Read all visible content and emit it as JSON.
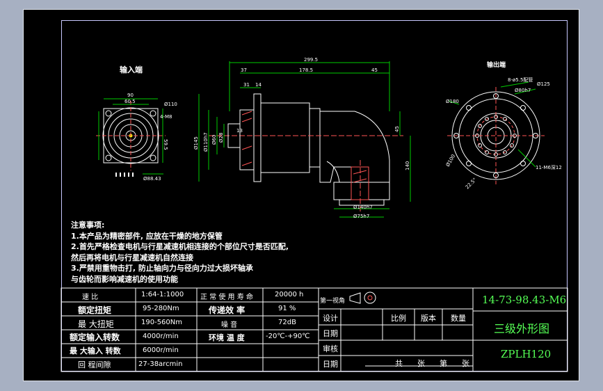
{
  "views": {
    "input_end_title": "输入端",
    "output_end_title": "输出端"
  },
  "dims": {
    "top_overall": "299.5",
    "len_37": "37",
    "len_178_5": "178.5",
    "len_45": "45",
    "len_31": "31",
    "len_14": "14",
    "left_90": "90",
    "left_60_5": "60.5",
    "left_dia110": "Ø110",
    "left_4_m8": "4-M8",
    "left_59_5": "59.5",
    "left_88_43": "Ø88.43",
    "mid_dia145": "Ø145",
    "mid_dia110": "Ø110h7",
    "mid_dia60": "Ø60",
    "mid_dia28": "Ø28",
    "mid_h7": "h7",
    "mid_45": "45",
    "mid_140": "140",
    "mid_13": "13",
    "bot_dia160": "Ø140h7",
    "bot_dia75": "Ø75h7",
    "right_8_phi5": "8-ø5.5配管",
    "right_dia125": "Ø125",
    "right_dia180": "Ø180",
    "right_dia80": "Ø80h7",
    "right_11_m6": "11-M6深12",
    "right_22_5": "22.5°",
    "right_dia100": "Ø100"
  },
  "notes": [
    "注意事项:",
    "1.本产品为精密部件, 应放在干燥的地方保管",
    "2.首先严格检查电机与行星减速机相连接的个部位尺寸是否匹配,",
    "然后再将电机与行星减速机自然连接",
    "3.严禁用重物击打, 防止轴向力与径向力过大损坏轴承",
    "与齿轮而影响减速机的使用功能"
  ],
  "specs": [
    {
      "label": "速 比",
      "value": "1:64-1:1000",
      "label2": "正 常 使 用 寿 命",
      "value2": "20000 h"
    },
    {
      "label": "额定扭矩",
      "value": "95-280Nm",
      "label2": "传递效 率",
      "value2": "91 %"
    },
    {
      "label": "最 大扭矩",
      "value": "190-560Nm",
      "label2": "噪 音",
      "value2": "72dB"
    },
    {
      "label": "额定输入转数",
      "value": "4000r/min",
      "label2": "环境 温 度",
      "value2": "-20℃-+90℃"
    },
    {
      "label": "最 大输入 转数",
      "value": "6000r/min",
      "label2": "",
      "value2": ""
    },
    {
      "label": "回 程间隙",
      "value": "27-38arcmin",
      "label2": "",
      "value2": ""
    }
  ],
  "titleblock": {
    "projection": "第一视角",
    "design": "设计",
    "date1": "日期",
    "audit": "审核",
    "date2": "日期",
    "scale": "比例",
    "version": "版本",
    "quantity": "数量",
    "total": "共",
    "sheets": "张",
    "no": "第",
    "sheet": "张",
    "drawing_no": "14-73-98.43-M6",
    "drawing_name": "三级外形图",
    "model": "ZPLH120"
  },
  "colors": {
    "sheet": "#000000",
    "frame": "#c8c8ff",
    "text_green": "#55ff55",
    "dim_green": "#00cc00",
    "hatch_red": "#ff5555"
  }
}
